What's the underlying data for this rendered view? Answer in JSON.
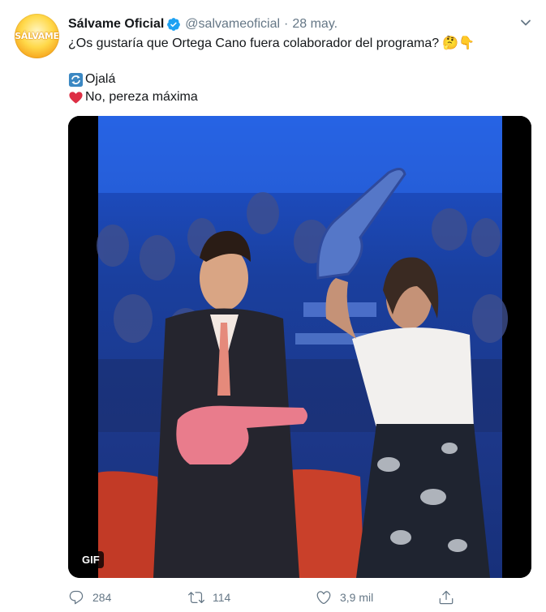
{
  "tweet": {
    "avatar_text": "SÁLVAME",
    "name": "Sálvame Oficial",
    "handle": "@salvameoficial",
    "separator": "·",
    "date": "28 may.",
    "text_line1": "¿Os gustaría que Ortega Cano fuera colaborador del programa?",
    "emoji_line1": "🤔👇",
    "option1": "Ojalá",
    "option2": "No, pereza máxima",
    "media_badge": "GIF"
  },
  "actions": {
    "replies": "284",
    "retweets": "114",
    "likes": "3,9 mil"
  },
  "colors": {
    "verified": "#1da1f2",
    "secondary_text": "#657786",
    "heart_emoji": "#dd2e44",
    "retweet_emoji": "#3b88c3"
  },
  "icons": [
    "verified-badge-icon",
    "caret-down-icon",
    "arrows-counterclockwise-emoji",
    "red-heart-emoji",
    "reply-icon",
    "retweet-icon",
    "like-icon",
    "share-icon"
  ]
}
